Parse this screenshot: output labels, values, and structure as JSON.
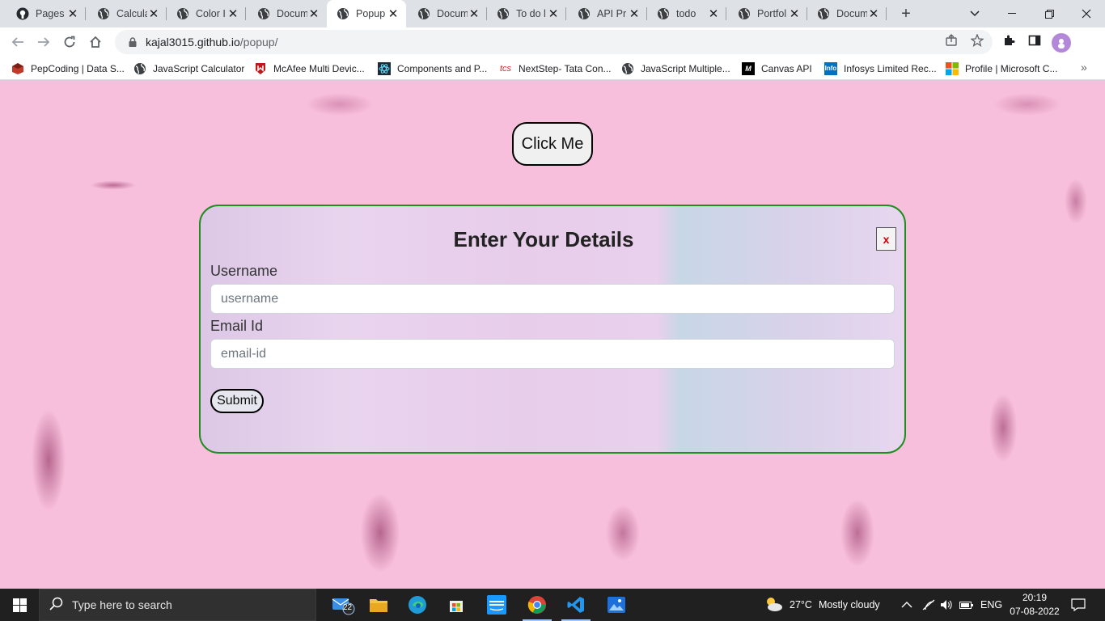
{
  "browser": {
    "tabs": [
      {
        "title": "Pages",
        "icon": "github-icon",
        "active": false
      },
      {
        "title": "Calcula",
        "icon": "globe-icon",
        "active": false
      },
      {
        "title": "Color I",
        "icon": "globe-icon",
        "active": false
      },
      {
        "title": "Docum",
        "icon": "globe-icon",
        "active": false
      },
      {
        "title": "Popup",
        "icon": "globe-icon",
        "active": true
      },
      {
        "title": "Docum",
        "icon": "globe-icon",
        "active": false
      },
      {
        "title": "To do l",
        "icon": "globe-icon",
        "active": false
      },
      {
        "title": "API Pr",
        "icon": "globe-icon",
        "active": false
      },
      {
        "title": "todo",
        "icon": "globe-icon",
        "active": false
      },
      {
        "title": "Portfol",
        "icon": "globe-icon",
        "active": false
      },
      {
        "title": "Docum",
        "icon": "globe-icon",
        "active": false
      }
    ],
    "address": {
      "host": "kajal3015.github.io",
      "path": "/popup/"
    },
    "bookmarks": [
      {
        "label": "PepCoding | Data S...",
        "icon": "pepcoding-icon"
      },
      {
        "label": "JavaScript Calculator",
        "icon": "globe-icon"
      },
      {
        "label": "McAfee Multi Devic...",
        "icon": "mcafee-icon"
      },
      {
        "label": "Components and P...",
        "icon": "react-icon"
      },
      {
        "label": "NextStep- Tata Con...",
        "icon": "tcs-icon",
        "icon_text": "tcs"
      },
      {
        "label": "JavaScript Multiple...",
        "icon": "globe-icon"
      },
      {
        "label": "Canvas API",
        "icon": "mdn-icon",
        "icon_text": "M"
      },
      {
        "label": "Infosys Limited Rec...",
        "icon": "infosys-icon",
        "icon_text": "Info"
      },
      {
        "label": "Profile | Microsoft C...",
        "icon": "microsoft-icon"
      }
    ]
  },
  "page": {
    "click_button": "Click Me",
    "popup": {
      "title": "Enter Your Details",
      "close": "x",
      "username_label": "Username",
      "username_placeholder": "username",
      "email_label": "Email Id",
      "email_placeholder": "email-id",
      "submit": "Submit"
    }
  },
  "taskbar": {
    "search_placeholder": "Type here to search",
    "mail_badge": "22",
    "weather": {
      "temp": "27°C",
      "condition": "Mostly cloudy"
    },
    "language": "ENG",
    "time": "20:19",
    "date": "07-08-2022"
  },
  "colors": {
    "page_background": "#f8bfdc",
    "popup_border": "#1e8e1e",
    "close_x": "#d40000",
    "taskbar": "#202020"
  }
}
